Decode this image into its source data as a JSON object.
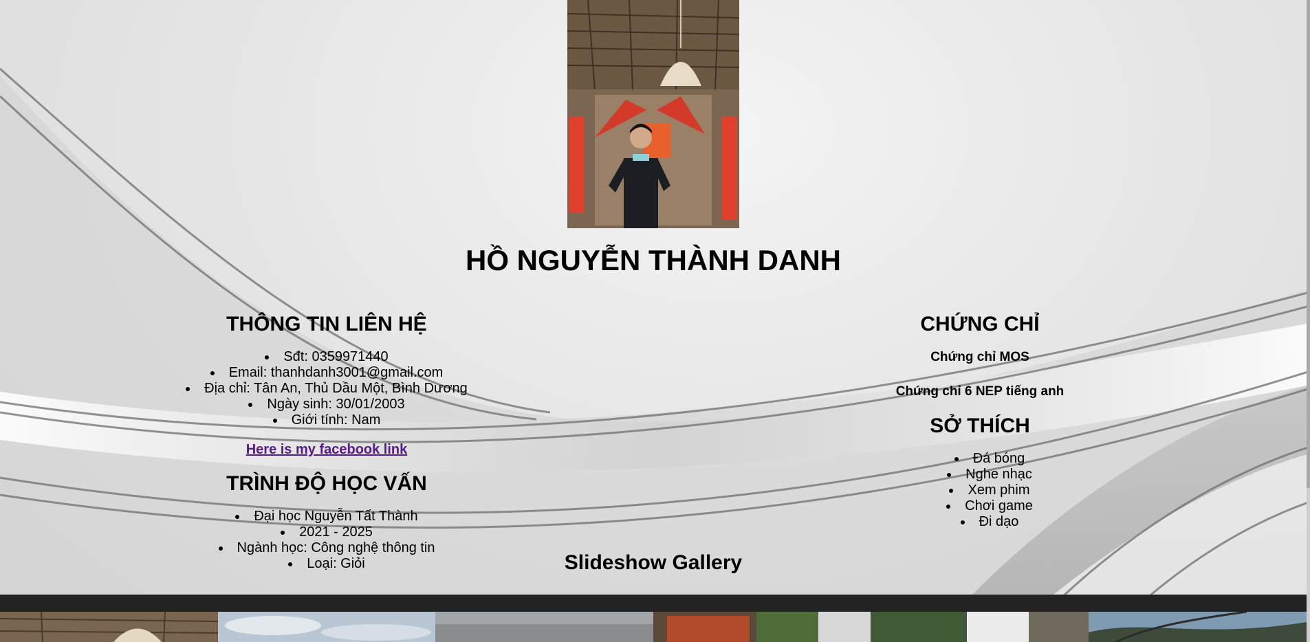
{
  "profile": {
    "name": "HỒ NGUYỄN THÀNH DANH",
    "photo_icon": "profile-photo"
  },
  "contact": {
    "title": "THÔNG TIN LIÊN HỆ",
    "items": [
      "Sđt: 0359971440",
      "Email: thanhdanh3001@gmail.com",
      "Địa chỉ: Tân An, Thủ Dầu Một, Bình Dương",
      "Ngày sinh: 30/01/2003",
      "Giới tính: Nam"
    ],
    "facebook_link": "Here is my facebook link"
  },
  "education": {
    "title": "TRÌNH ĐỘ HỌC VẤN",
    "items": [
      "Đại học Nguyễn Tất Thành",
      "2021 - 2025",
      "Ngành học: Công nghệ thông tin",
      "Loại: Giỏi"
    ]
  },
  "certificates": {
    "title": "CHỨNG CHỈ",
    "items": [
      "Chứng chỉ MOS",
      "Chứng chỉ 6 NEP tiếng anh"
    ]
  },
  "hobbies": {
    "title": "SỞ THÍCH",
    "items": [
      "Đá bóng",
      "Nghe nhạc",
      "Xem phim",
      "Chơi game",
      "Đi dạo"
    ]
  },
  "gallery": {
    "title": "Slideshow Gallery",
    "thumbnails": [
      "thumbnail-1",
      "thumbnail-2",
      "thumbnail-3",
      "thumbnail-4",
      "thumbnail-5",
      "thumbnail-6"
    ]
  },
  "colors": {
    "link": "#551a8b",
    "gallery_bar": "#222222"
  }
}
